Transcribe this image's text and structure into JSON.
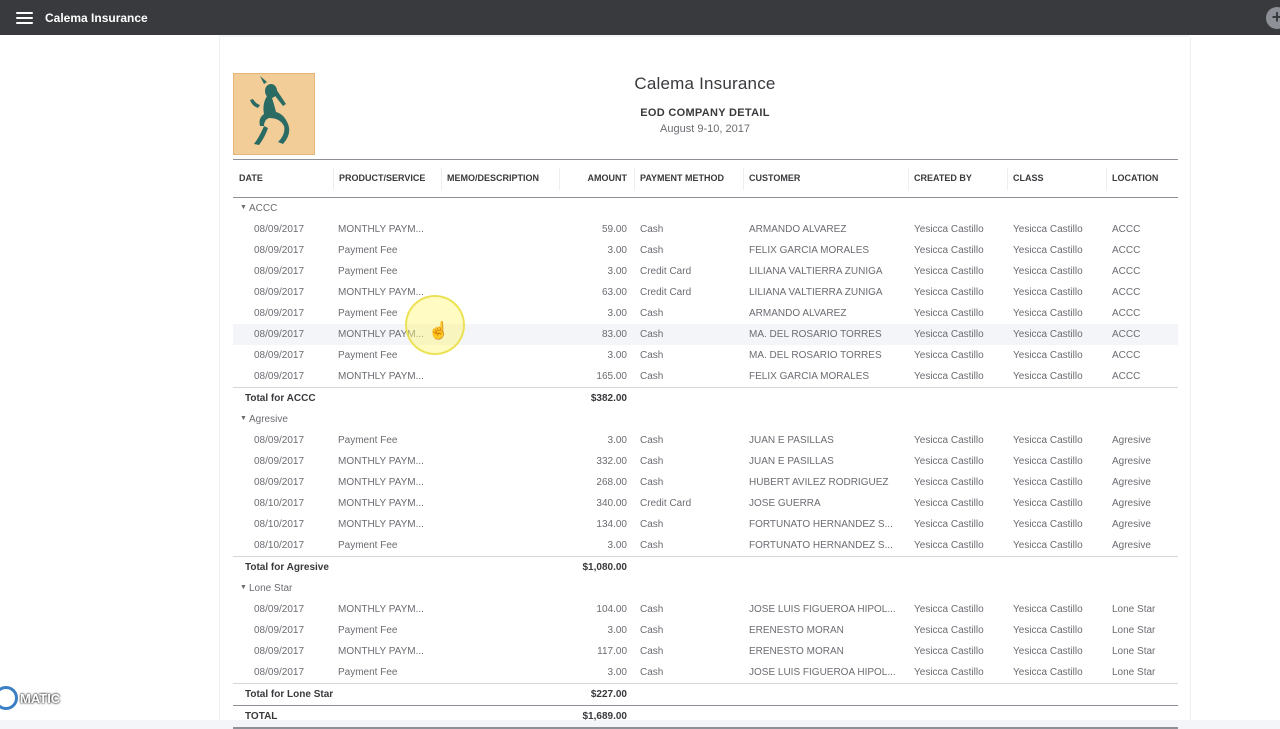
{
  "app": {
    "company_name": "Calema Insurance",
    "plus_icon": "+",
    "colors": {
      "topbar": "#393a3d",
      "logo_bg": "#f2cd98",
      "logo_figure": "#2a6b63"
    }
  },
  "report": {
    "company": "Calema Insurance",
    "title": "EOD COMPANY DETAIL",
    "dates": "August 9-10, 2017",
    "columns": [
      "DATE",
      "PRODUCT/SERVICE",
      "MEMO/DESCRIPTION",
      "AMOUNT",
      "PAYMENT METHOD",
      "CUSTOMER",
      "CREATED BY",
      "CLASS",
      "LOCATION"
    ],
    "groups": [
      {
        "name": "ACCC",
        "rows": [
          [
            "08/09/2017",
            "MONTHLY PAYM...",
            "",
            "59.00",
            "Cash",
            "ARMANDO ALVAREZ",
            "Yesicca Castillo",
            "Yesicca Castillo",
            "ACCC"
          ],
          [
            "08/09/2017",
            "Payment Fee",
            "",
            "3.00",
            "Cash",
            "FELIX GARCIA MORALES",
            "Yesicca Castillo",
            "Yesicca Castillo",
            "ACCC"
          ],
          [
            "08/09/2017",
            "Payment Fee",
            "",
            "3.00",
            "Credit Card",
            "LILIANA VALTIERRA ZUNIGA",
            "Yesicca Castillo",
            "Yesicca Castillo",
            "ACCC"
          ],
          [
            "08/09/2017",
            "MONTHLY PAYM...",
            "",
            "63.00",
            "Credit Card",
            "LILIANA VALTIERRA ZUNIGA",
            "Yesicca Castillo",
            "Yesicca Castillo",
            "ACCC"
          ],
          [
            "08/09/2017",
            "Payment Fee",
            "",
            "3.00",
            "Cash",
            "ARMANDO ALVAREZ",
            "Yesicca Castillo",
            "Yesicca Castillo",
            "ACCC"
          ],
          [
            "08/09/2017",
            "MONTHLY PAYM...",
            "",
            "83.00",
            "Cash",
            "MA. DEL ROSARIO TORRES",
            "Yesicca Castillo",
            "Yesicca Castillo",
            "ACCC"
          ],
          [
            "08/09/2017",
            "Payment Fee",
            "",
            "3.00",
            "Cash",
            "MA. DEL ROSARIO TORRES",
            "Yesicca Castillo",
            "Yesicca Castillo",
            "ACCC"
          ],
          [
            "08/09/2017",
            "MONTHLY PAYM...",
            "",
            "165.00",
            "Cash",
            "FELIX GARCIA MORALES",
            "Yesicca Castillo",
            "Yesicca Castillo",
            "ACCC"
          ]
        ],
        "total_label": "Total for ACCC",
        "total": "$382.00"
      },
      {
        "name": "Agresive",
        "rows": [
          [
            "08/09/2017",
            "Payment Fee",
            "",
            "3.00",
            "Cash",
            "JUAN E PASILLAS",
            "Yesicca Castillo",
            "Yesicca Castillo",
            "Agresive"
          ],
          [
            "08/09/2017",
            "MONTHLY PAYM...",
            "",
            "332.00",
            "Cash",
            "JUAN E PASILLAS",
            "Yesicca Castillo",
            "Yesicca Castillo",
            "Agresive"
          ],
          [
            "08/09/2017",
            "MONTHLY PAYM...",
            "",
            "268.00",
            "Cash",
            "HUBERT AVILEZ RODRIGUEZ",
            "Yesicca Castillo",
            "Yesicca Castillo",
            "Agresive"
          ],
          [
            "08/10/2017",
            "MONTHLY PAYM...",
            "",
            "340.00",
            "Credit Card",
            "JOSE GUERRA",
            "Yesicca Castillo",
            "Yesicca Castillo",
            "Agresive"
          ],
          [
            "08/10/2017",
            "MONTHLY PAYM...",
            "",
            "134.00",
            "Cash",
            "FORTUNATO HERNANDEZ S...",
            "Yesicca Castillo",
            "Yesicca Castillo",
            "Agresive"
          ],
          [
            "08/10/2017",
            "Payment Fee",
            "",
            "3.00",
            "Cash",
            "FORTUNATO HERNANDEZ S...",
            "Yesicca Castillo",
            "Yesicca Castillo",
            "Agresive"
          ]
        ],
        "total_label": "Total for Agresive",
        "total": "$1,080.00"
      },
      {
        "name": "Lone Star",
        "rows": [
          [
            "08/09/2017",
            "MONTHLY PAYM...",
            "",
            "104.00",
            "Cash",
            "JOSE LUIS FIGUEROA HIPOL...",
            "Yesicca Castillo",
            "Yesicca Castillo",
            "Lone Star"
          ],
          [
            "08/09/2017",
            "Payment Fee",
            "",
            "3.00",
            "Cash",
            "ERENESTO MORAN",
            "Yesicca Castillo",
            "Yesicca Castillo",
            "Lone Star"
          ],
          [
            "08/09/2017",
            "MONTHLY PAYM...",
            "",
            "117.00",
            "Cash",
            "ERENESTO MORAN",
            "Yesicca Castillo",
            "Yesicca Castillo",
            "Lone Star"
          ],
          [
            "08/09/2017",
            "Payment Fee",
            "",
            "3.00",
            "Cash",
            "JOSE LUIS FIGUEROA HIPOL...",
            "Yesicca Castillo",
            "Yesicca Castillo",
            "Lone Star"
          ]
        ],
        "total_label": "Total for Lone Star",
        "total": "$227.00"
      }
    ],
    "grand_total_label": "TOTAL",
    "grand_total": "$1,689.00"
  },
  "watermark": {
    "text": "MATIC"
  }
}
